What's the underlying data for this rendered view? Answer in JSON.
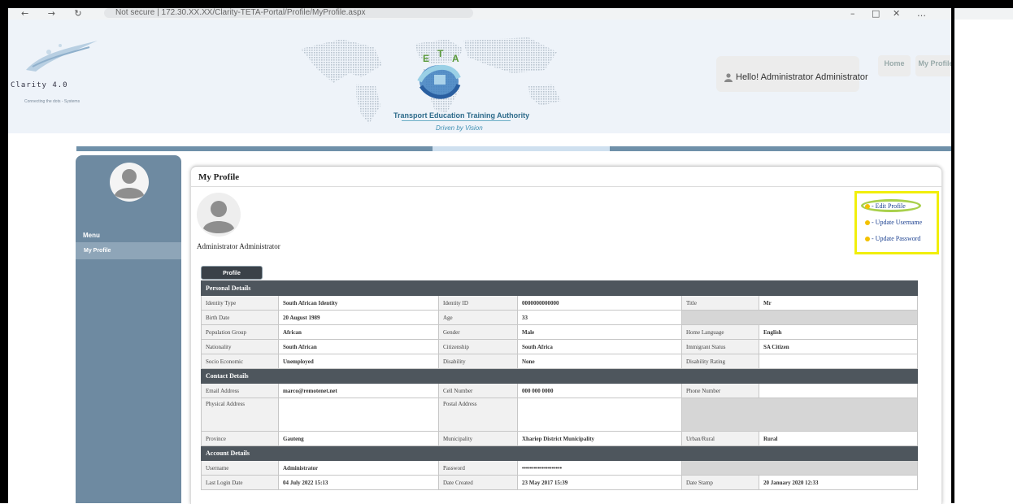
{
  "browser": {
    "nav_icons": "← → ↻",
    "url_text": "Not secure | 172.30.XX.XX/Clarity-TETA-Portal/Profile/MyProfile.aspx",
    "window_icons": [
      "–",
      "□",
      "✕",
      "…"
    ]
  },
  "header": {
    "logo_title": "Clarity 4.0",
    "logo_tagline": "Connecting the dots - Systems",
    "teta_name": "Transport Education Training Authority",
    "teta_tagline": "Driven by Vision",
    "greeting": "Hello! Administrator Administrator",
    "nav": [
      "Home",
      "My Profile"
    ]
  },
  "sidebar": {
    "menu_title": "Menu",
    "items": [
      "My Profile"
    ]
  },
  "profile": {
    "title": "My Profile",
    "user_name": "Administrator Administrator",
    "actions": [
      "- Edit Profile",
      "- Update Username",
      "- Update Password"
    ],
    "tab_label": "Profile",
    "personal_title": "Personal Details",
    "personal": {
      "identity_type_label": "Identity Type",
      "identity_type": "South African Identity",
      "identity_id_label": "Identity ID",
      "identity_id": "0000000000000",
      "title_label": "Title",
      "title": "Mr",
      "birth_date_label": "Birth Date",
      "birth_date": "20 August 1989",
      "age_label": "Age",
      "age": "33",
      "population_label": "Population Group",
      "population": "African",
      "gender_label": "Gender",
      "gender": "Male",
      "language_label": "Home Language",
      "language": "English",
      "nationality_label": "Nationality",
      "nationality": "South African",
      "citizenship_label": "Citizenship",
      "citizenship": "South Africa",
      "immigrant_label": "Immigrant Status",
      "immigrant": "SA Citizen",
      "socio_label": "Socio Economic",
      "socio": "Unemployed",
      "disability_label": "Disability",
      "disability": "None",
      "disability_rating_label": "Disability Rating"
    },
    "contact_title": "Contact Details",
    "contact": {
      "email_label": "Email Address",
      "email": "marco@remotenet.net",
      "cell_label": "Cell Number",
      "cell": "000 000 0000",
      "phone_label": "Phone Number",
      "physical_label": "Physical Address",
      "postal_label": "Postal Address",
      "province_label": "Province",
      "province": "Gauteng",
      "municipality_label": "Municipality",
      "municipality": "Xhariep District Municipality",
      "urban_label": "Urban/Rural",
      "urban": "Rural"
    },
    "account_title": "Account Details",
    "account": {
      "username_label": "Username",
      "username": "Administrator",
      "password_label": "Password",
      "password": "••••••••••••••••••••",
      "last_login_label": "Last Login Date",
      "last_login": "04 July 2022 15:13",
      "created_label": "Date Created",
      "created": "23 May 2017 15:39",
      "stamp_label": "Date Stamp",
      "stamp": "20 January 2020 12:33"
    }
  }
}
